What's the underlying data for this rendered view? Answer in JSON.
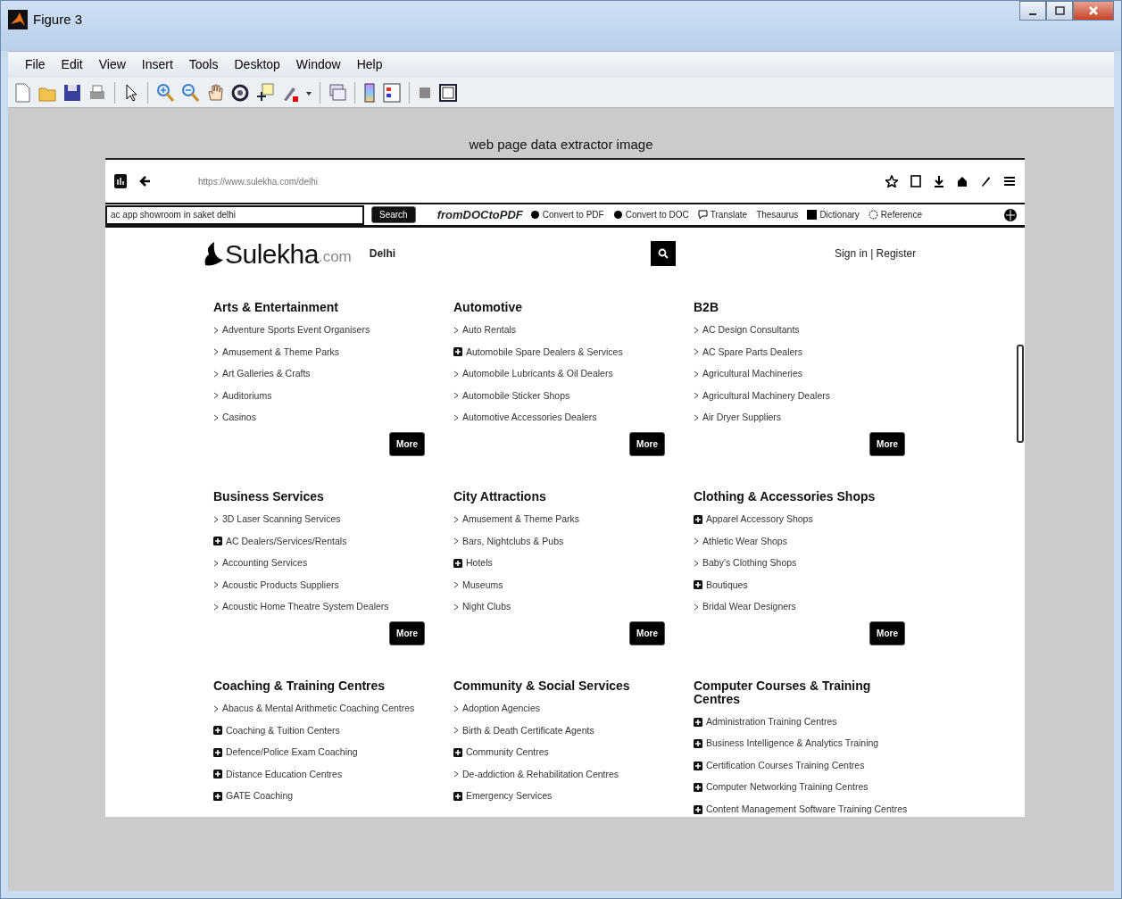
{
  "window": {
    "title": "Figure 3"
  },
  "menu": [
    "File",
    "Edit",
    "View",
    "Insert",
    "Tools",
    "Desktop",
    "Window",
    "Help"
  ],
  "figure": {
    "title": "web page data extractor image"
  },
  "browser": {
    "url": "https://www.sulekha.com/delhi",
    "search": {
      "value": "ac app showroom in saket delhi"
    },
    "search_button": "Search",
    "addon": "fromDOCtoPDF",
    "tools": [
      {
        "label": "Convert to PDF",
        "kind": "pdf"
      },
      {
        "label": "Convert to DOC",
        "kind": "doc"
      },
      {
        "label": "Translate",
        "kind": "translate"
      },
      {
        "label": "Thesaurus",
        "kind": "plain"
      },
      {
        "label": "Dictionary",
        "kind": "dict"
      },
      {
        "label": "Reference",
        "kind": "ref"
      }
    ]
  },
  "site": {
    "logo": "Sulekha",
    "logo_suffix": ".com",
    "city": "Delhi",
    "auth": "Sign in | Register"
  },
  "categories": [
    {
      "title": "Arts & Entertainment",
      "more": "More",
      "items": [
        {
          "label": "Adventure Sports Event Organisers",
          "kind": "arrow"
        },
        {
          "label": "Amusement & Theme Parks",
          "kind": "arrow"
        },
        {
          "label": "Art Galleries & Crafts",
          "kind": "arrow"
        },
        {
          "label": "Auditoriums",
          "kind": "arrow"
        },
        {
          "label": "Casinos",
          "kind": "arrow"
        }
      ]
    },
    {
      "title": "Automotive",
      "more": "More",
      "items": [
        {
          "label": "Auto Rentals",
          "kind": "arrow"
        },
        {
          "label": "Automobile Spare Dealers & Services",
          "kind": "plus"
        },
        {
          "label": "Automobile Lubricants & Oil Dealers",
          "kind": "arrow"
        },
        {
          "label": "Automobile Sticker Shops",
          "kind": "arrow"
        },
        {
          "label": "Automotive Accessories Dealers",
          "kind": "arrow"
        }
      ]
    },
    {
      "title": "B2B",
      "more": "More",
      "items": [
        {
          "label": "AC Design Consultants",
          "kind": "arrow"
        },
        {
          "label": "AC Spare Parts Dealers",
          "kind": "arrow"
        },
        {
          "label": "Agricultural Machineries",
          "kind": "arrow"
        },
        {
          "label": "Agricultural Machinery Dealers",
          "kind": "arrow"
        },
        {
          "label": "Air Dryer Suppliers",
          "kind": "arrow"
        }
      ]
    },
    {
      "title": "Business Services",
      "more": "More",
      "items": [
        {
          "label": "3D Laser Scanning Services",
          "kind": "arrow"
        },
        {
          "label": "AC Dealers/Services/Rentals",
          "kind": "plus"
        },
        {
          "label": "Accounting Services",
          "kind": "arrow"
        },
        {
          "label": "Acoustic Products Suppliers",
          "kind": "arrow"
        },
        {
          "label": "Acoustic Home Theatre System Dealers",
          "kind": "arrow"
        }
      ]
    },
    {
      "title": "City Attractions",
      "more": "More",
      "items": [
        {
          "label": "Amusement & Theme Parks",
          "kind": "arrow"
        },
        {
          "label": "Bars, Nightclubs & Pubs",
          "kind": "arrow"
        },
        {
          "label": "Hotels",
          "kind": "plus"
        },
        {
          "label": "Museums",
          "kind": "arrow"
        },
        {
          "label": "Night Clubs",
          "kind": "arrow"
        }
      ]
    },
    {
      "title": "Clothing & Accessories Shops",
      "more": "More",
      "items": [
        {
          "label": "Apparel Accessory Shops",
          "kind": "plus"
        },
        {
          "label": "Athletic Wear Shops",
          "kind": "arrow"
        },
        {
          "label": "Baby's Clothing Shops",
          "kind": "arrow"
        },
        {
          "label": "Boutiques",
          "kind": "plus"
        },
        {
          "label": "Bridal Wear Designers",
          "kind": "arrow"
        }
      ]
    },
    {
      "title": "Coaching & Training Centres",
      "items": [
        {
          "label": "Abacus & Mental Arithmetic Coaching Centres",
          "kind": "arrow"
        },
        {
          "label": "Coaching & Tuition Centers",
          "kind": "plus"
        },
        {
          "label": "Defence/Police Exam Coaching",
          "kind": "plus"
        },
        {
          "label": "Distance Education Centres",
          "kind": "plus"
        },
        {
          "label": "GATE Coaching",
          "kind": "plus"
        }
      ]
    },
    {
      "title": "Community & Social Services",
      "items": [
        {
          "label": "Adoption Agencies",
          "kind": "arrow"
        },
        {
          "label": "Birth & Death Certificate Agents",
          "kind": "arrow"
        },
        {
          "label": "Community Centres",
          "kind": "plus"
        },
        {
          "label": "De-addiction & Rehabilitation Centres",
          "kind": "arrow"
        },
        {
          "label": "Emergency Services",
          "kind": "plus"
        }
      ]
    },
    {
      "title": "Computer Courses & Training Centres",
      "items": [
        {
          "label": "Administration Training Centres",
          "kind": "plus"
        },
        {
          "label": "Business Intelligence & Analytics Training",
          "kind": "plus"
        },
        {
          "label": "Certification Courses Training Centres",
          "kind": "plus"
        },
        {
          "label": "Computer Networking Training Centres",
          "kind": "plus"
        },
        {
          "label": "Content Management Software Training Centres",
          "kind": "plus"
        }
      ]
    }
  ]
}
